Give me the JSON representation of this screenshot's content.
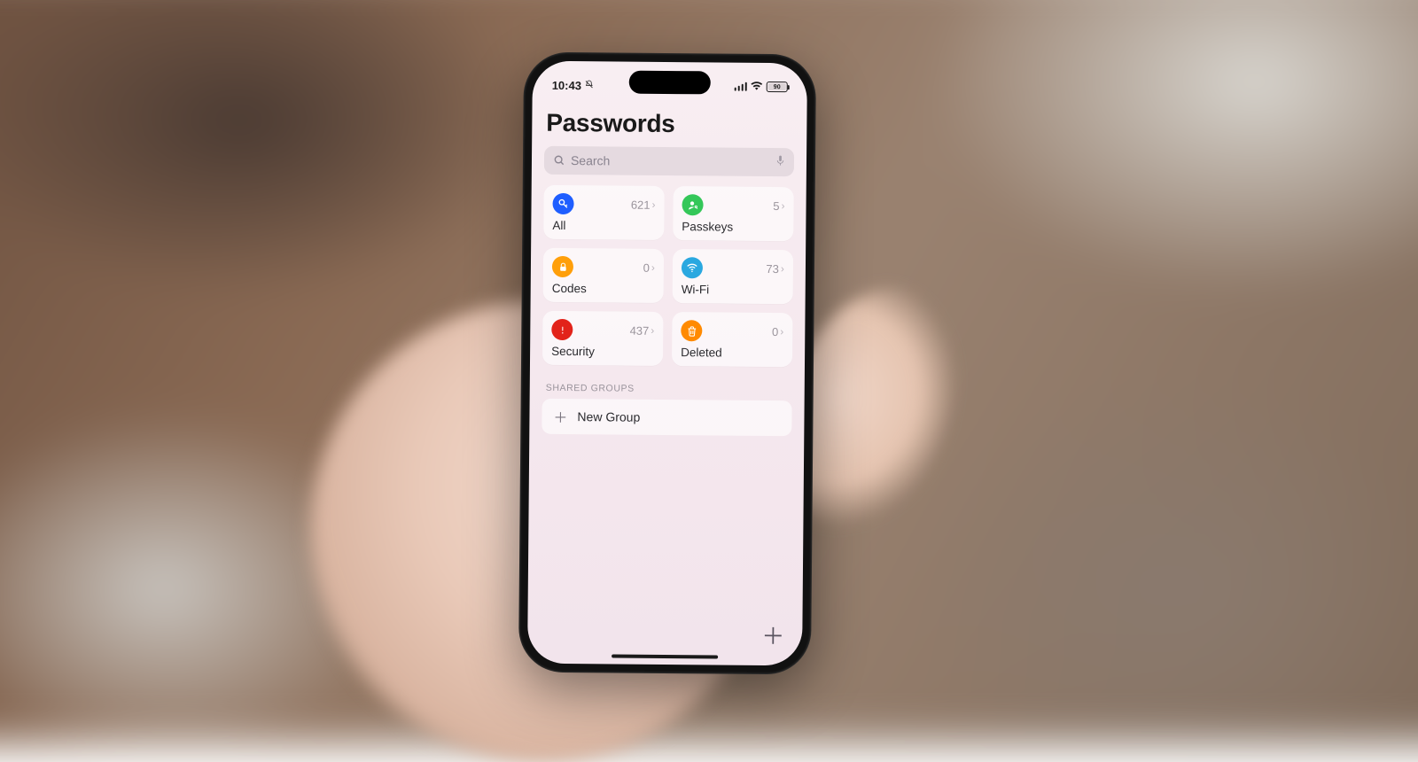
{
  "status": {
    "time": "10:43",
    "battery": "90"
  },
  "title": "Passwords",
  "search": {
    "placeholder": "Search"
  },
  "tiles": {
    "all": {
      "label": "All",
      "count": "621"
    },
    "passkeys": {
      "label": "Passkeys",
      "count": "5"
    },
    "codes": {
      "label": "Codes",
      "count": "0"
    },
    "wifi": {
      "label": "Wi-Fi",
      "count": "73"
    },
    "security": {
      "label": "Security",
      "count": "437"
    },
    "deleted": {
      "label": "Deleted",
      "count": "0"
    }
  },
  "shared": {
    "header": "SHARED GROUPS",
    "new_group": "New Group"
  }
}
